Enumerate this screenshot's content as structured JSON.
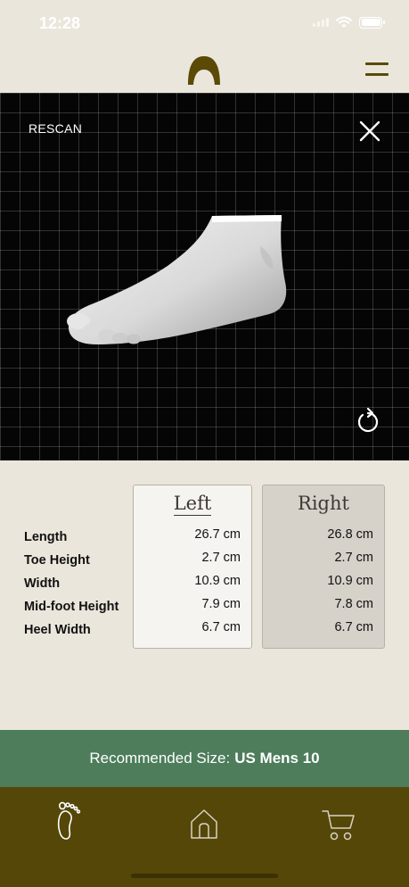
{
  "status_bar": {
    "time": "12:28"
  },
  "header": {
    "logo_icon": "arch-logo-icon",
    "menu_icon": "hamburger-menu-icon"
  },
  "viewer": {
    "rescan_label": "RESCAN",
    "close_icon": "close-icon",
    "rotate_icon": "rotate-icon",
    "model": "foot-3d-model"
  },
  "measurements": {
    "labels": [
      "Length",
      "Toe Height",
      "Width",
      "Mid-foot Height",
      "Heel Width"
    ],
    "left": {
      "title": "Left",
      "values": [
        "26.7 cm",
        "2.7 cm",
        "10.9 cm",
        "7.9 cm",
        "6.7 cm"
      ]
    },
    "right": {
      "title": "Right",
      "values": [
        "26.8 cm",
        "2.7 cm",
        "10.9 cm",
        "7.8 cm",
        "6.7 cm"
      ]
    }
  },
  "recommendation": {
    "label": "Recommended Size:",
    "value": "US Mens 10"
  },
  "tab_bar": {
    "items": [
      {
        "name": "foot-scan",
        "icon": "foot-icon"
      },
      {
        "name": "home",
        "icon": "home-icon"
      },
      {
        "name": "cart",
        "icon": "cart-icon"
      }
    ]
  },
  "colors": {
    "background": "#ebe6dc",
    "accent_olive": "#554708",
    "recommendation_green": "#4d7d5b",
    "viewer_background": "#050505"
  }
}
